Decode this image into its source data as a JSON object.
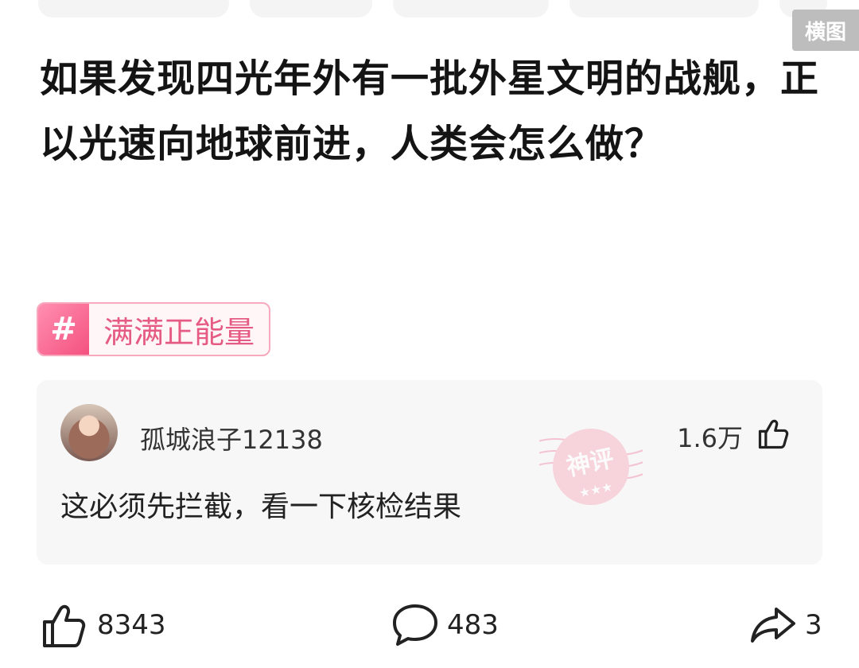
{
  "header": {
    "landscape_badge": "横图"
  },
  "question": {
    "title": "如果发现四光年外有一批外星文明的战舰，正以光速向地球前进，人类会怎么做？"
  },
  "topic": {
    "hash_symbol": "#",
    "label": "满满正能量"
  },
  "comment": {
    "username": "孤城浪子12138",
    "likes": "1.6万",
    "text": "这必须先拦截，看一下核检结果",
    "badge": "神评",
    "badge_stars": "★★★"
  },
  "actions": {
    "likes": "8343",
    "comments": "483",
    "shares": "3"
  },
  "colors": {
    "accent_pink": "#f4517f",
    "tag_text": "#e65b83"
  },
  "icons": [
    "thumbs-up-icon",
    "comment-bubble-icon",
    "share-arrow-icon"
  ]
}
